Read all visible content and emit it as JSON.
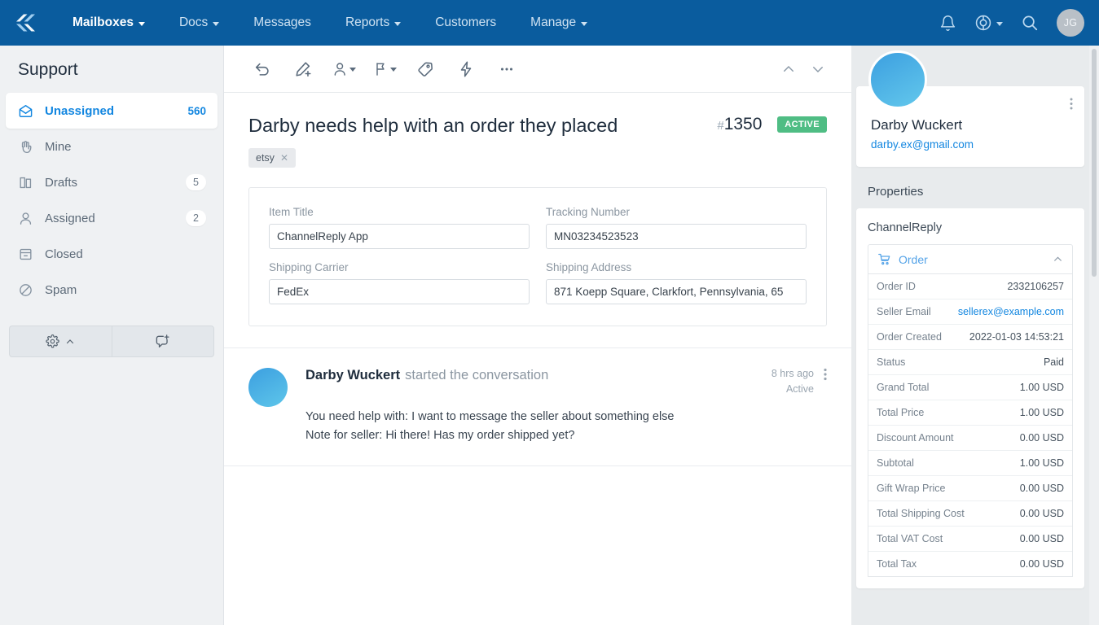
{
  "topnav": {
    "logo_name": "helpscout-logo",
    "links": [
      {
        "label": "Mailboxes",
        "caret": true,
        "active": true
      },
      {
        "label": "Docs",
        "caret": true,
        "active": false
      },
      {
        "label": "Messages",
        "caret": false,
        "active": false
      },
      {
        "label": "Reports",
        "caret": true,
        "active": false
      },
      {
        "label": "Customers",
        "caret": false,
        "active": false
      },
      {
        "label": "Manage",
        "caret": true,
        "active": false
      }
    ],
    "avatar_initials": "JG",
    "brand_color": "#0a5c9e"
  },
  "sidebar": {
    "title": "Support",
    "items": [
      {
        "label": "Unassigned",
        "count": "560",
        "icon": "inbox-icon",
        "selected": true
      },
      {
        "label": "Mine",
        "count": "",
        "icon": "hand-icon",
        "selected": false
      },
      {
        "label": "Drafts",
        "count": "5",
        "icon": "drafts-icon",
        "selected": false
      },
      {
        "label": "Assigned",
        "count": "2",
        "icon": "person-icon",
        "selected": false
      },
      {
        "label": "Closed",
        "count": "",
        "icon": "archive-icon",
        "selected": false
      },
      {
        "label": "Spam",
        "count": "",
        "icon": "spam-icon",
        "selected": false
      }
    ]
  },
  "conversation": {
    "title": "Darby needs help with an order they placed",
    "hash": "#",
    "number": "1350",
    "status_badge": "ACTIVE",
    "status_color": "#4fbd84",
    "tags": [
      {
        "label": "etsy"
      }
    ]
  },
  "order_form": {
    "fields": [
      {
        "label": "Item Title",
        "value": "ChannelReply App"
      },
      {
        "label": "Tracking Number",
        "value": "MN03234523523"
      },
      {
        "label": "Shipping Carrier",
        "value": "FedEx"
      },
      {
        "label": "Shipping Address",
        "value": "871 Koepp Square, Clarkfort, Pennsylvania, 65"
      }
    ]
  },
  "message": {
    "author": "Darby Wuckert",
    "action": "started the conversation",
    "time": "8 hrs ago",
    "status": "Active",
    "line1": "You need help with: I want to message the seller about something else",
    "line2": "Note for seller: Hi there! Has my order shipped yet?"
  },
  "customer": {
    "name": "Darby Wuckert",
    "email": "darby.ex@gmail.com"
  },
  "properties": {
    "heading": "Properties",
    "app_name": "ChannelReply",
    "section_title": "Order",
    "rows": [
      {
        "key": "Order ID",
        "value": "2332106257",
        "link": false
      },
      {
        "key": "Seller Email",
        "value": "sellerex@example.com",
        "link": true
      },
      {
        "key": "Order Created",
        "value": "2022-01-03 14:53:21",
        "link": false
      },
      {
        "key": "Status",
        "value": "Paid",
        "link": false
      },
      {
        "key": "Grand Total",
        "value": "1.00 USD",
        "link": false
      },
      {
        "key": "Total Price",
        "value": "1.00 USD",
        "link": false
      },
      {
        "key": "Discount Amount",
        "value": "0.00 USD",
        "link": false
      },
      {
        "key": "Subtotal",
        "value": "1.00 USD",
        "link": false
      },
      {
        "key": "Gift Wrap Price",
        "value": "0.00 USD",
        "link": false
      },
      {
        "key": "Total Shipping Cost",
        "value": "0.00 USD",
        "link": false
      },
      {
        "key": "Total VAT Cost",
        "value": "0.00 USD",
        "link": false
      },
      {
        "key": "Total Tax",
        "value": "0.00 USD",
        "link": false
      }
    ]
  }
}
